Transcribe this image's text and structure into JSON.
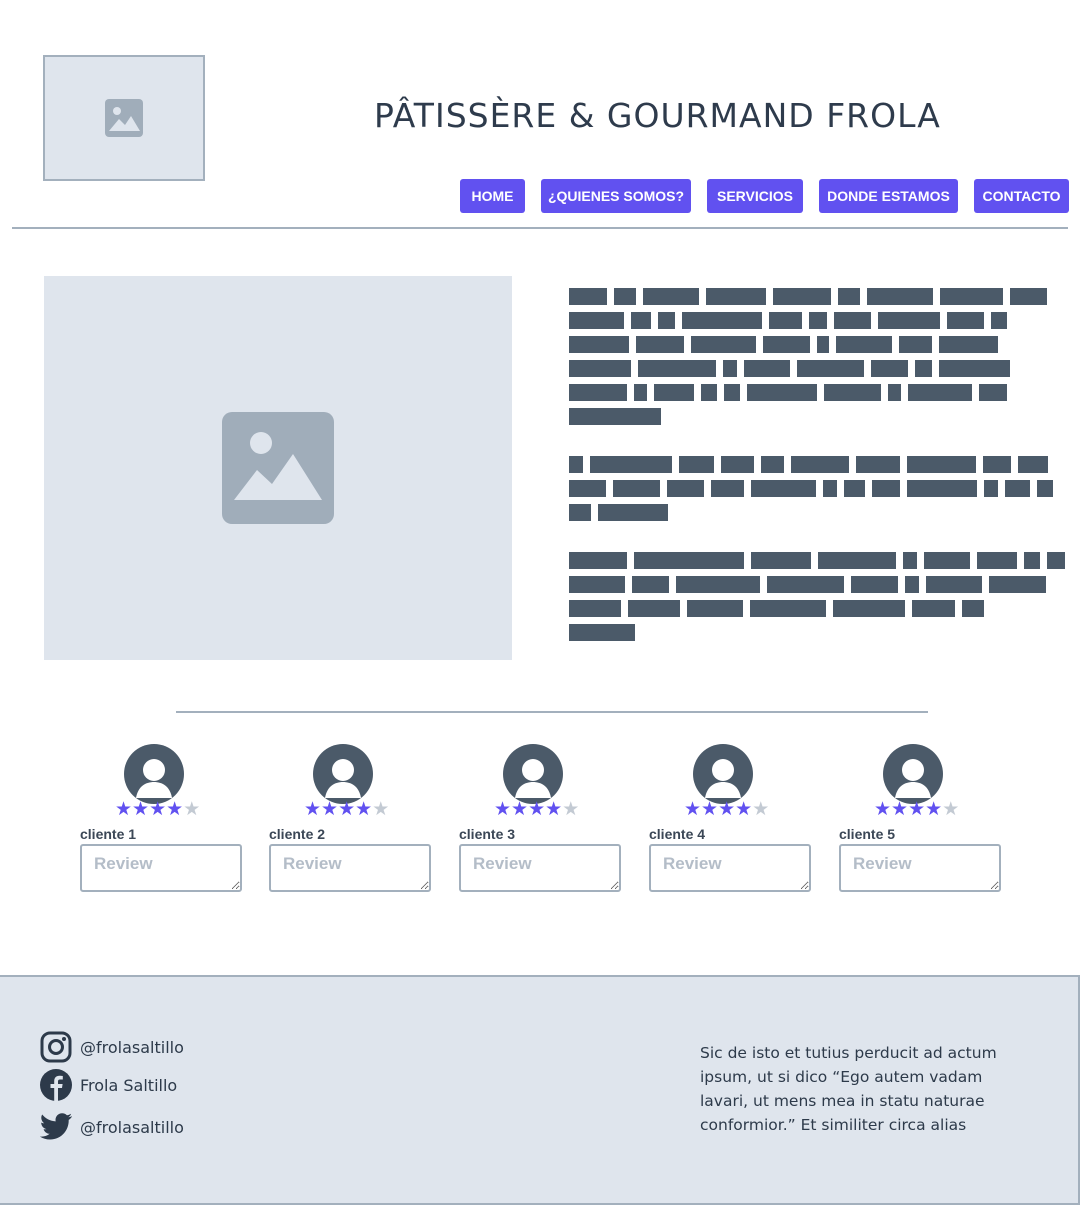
{
  "header": {
    "title": "PÂTISSÈRE & GOURMAND  FROLA"
  },
  "nav": {
    "items": [
      {
        "label": "HOME"
      },
      {
        "label": "¿QUIENES SOMOS?"
      },
      {
        "label": "SERVICIOS"
      },
      {
        "label": "DONDE ESTAMOS"
      },
      {
        "label": "CONTACTO"
      }
    ],
    "accent_color": "#6151f0"
  },
  "reviews": [
    {
      "name": "cliente 1",
      "rating": 4,
      "max_rating": 5,
      "placeholder": "Review"
    },
    {
      "name": "cliente 2",
      "rating": 4,
      "max_rating": 5,
      "placeholder": "Review"
    },
    {
      "name": "cliente 3",
      "rating": 4,
      "max_rating": 5,
      "placeholder": "Review"
    },
    {
      "name": "cliente 4",
      "rating": 4,
      "max_rating": 5,
      "placeholder": "Review"
    },
    {
      "name": "cliente 5",
      "rating": 4,
      "max_rating": 5,
      "placeholder": "Review"
    }
  ],
  "footer": {
    "social": [
      {
        "icon": "instagram-icon",
        "label": "@frolasaltillo"
      },
      {
        "icon": "facebook-icon",
        "label": "Frola Saltillo"
      },
      {
        "icon": "twitter-icon",
        "label": "@frolasaltillo"
      }
    ],
    "text": "Sic de isto et tutius perducit ad actum ipsum, ut si dico “Ego autem vadam lavari, ut mens mea in statu naturae conformior.” Et similiter circa alias"
  },
  "colors": {
    "placeholder_bg": "#dfe5ed",
    "placeholder_icon": "#a0adba",
    "redacted_text": "#4b5a69",
    "divider": "#a3b0bd"
  }
}
